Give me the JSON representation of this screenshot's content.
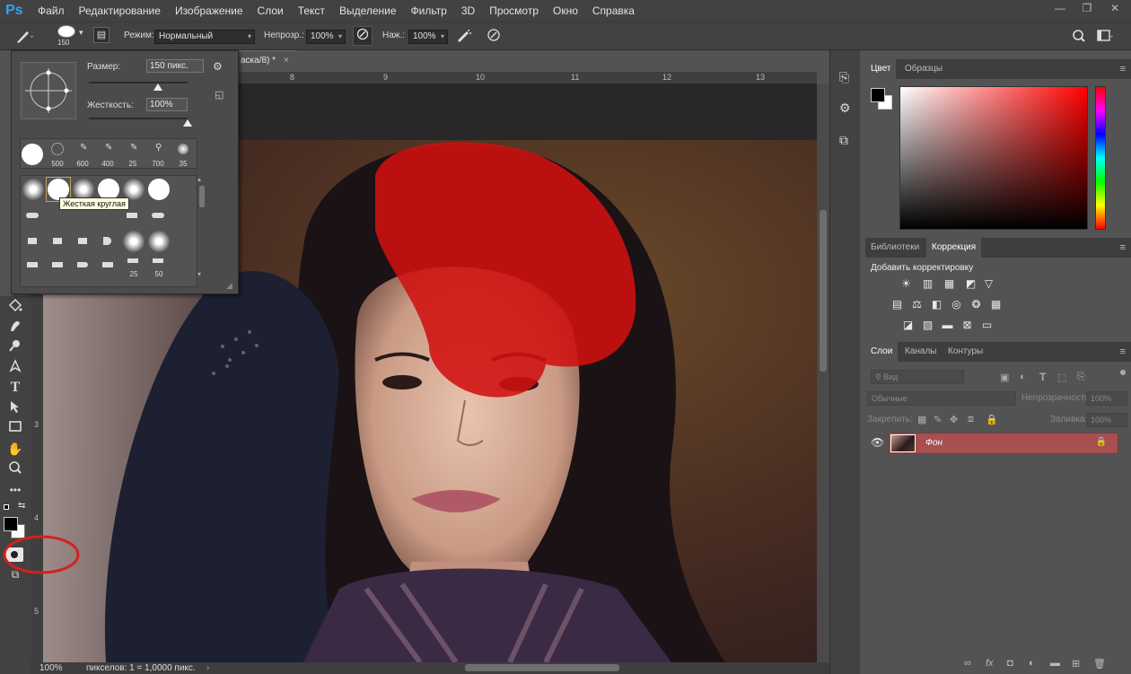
{
  "app": {
    "logo": "Ps"
  },
  "menu": [
    "Файл",
    "Редактирование",
    "Изображение",
    "Слои",
    "Текст",
    "Выделение",
    "Фильтр",
    "3D",
    "Просмотр",
    "Окно",
    "Справка"
  ],
  "window_controls": {
    "minimize": "—",
    "restore": "❐",
    "close": "✕"
  },
  "options": {
    "brush_size": "150",
    "mode_label": "Режим:",
    "mode_value": "Нормальный",
    "opacity_label": "Непрозр.:",
    "opacity_value": "100%",
    "flow_label": "Наж.:",
    "flow_value": "100%"
  },
  "document": {
    "tab_title": "аска/8) *",
    "tab_close": "×",
    "zoom": "100%",
    "status": "пикселов: 1 = 1,0000 пикс."
  },
  "ruler": {
    "top": [
      "8",
      "9",
      "10",
      "11",
      "12",
      "13"
    ],
    "left": [
      "3",
      "4",
      "5"
    ]
  },
  "brush_panel": {
    "size_label": "Размер:",
    "size_value": "150 пикс.",
    "hardness_label": "Жесткость:",
    "hardness_value": "100%",
    "size_level": 0.7,
    "hardness_level": 1.0,
    "presets": [
      "",
      "500",
      "600",
      "400",
      "25",
      "700",
      "35"
    ],
    "grid_numbers": [
      "25",
      "50"
    ],
    "tooltip": "Жесткая круглая"
  },
  "color_panel": {
    "tabs": [
      "Цвет",
      "Образцы"
    ],
    "foreground": "#000000",
    "background": "#ffffff",
    "hue": "#ff0000"
  },
  "adjust_panel": {
    "tabs": [
      "Библиотеки",
      "Коррекция"
    ],
    "heading": "Добавить корректировку"
  },
  "layers_panel": {
    "tabs": [
      "Слои",
      "Каналы",
      "Контуры"
    ],
    "search_placeholder": "Вид",
    "blend_mode": "Обычные",
    "opacity_label": "Непрозрачность:",
    "opacity_value": "100%",
    "lock_label": "Закрепить:",
    "fill_label": "Заливка:",
    "fill_value": "100%",
    "layer_name": "Фон",
    "footer_icons": [
      "link-icon",
      "fx-icon",
      "mask-icon",
      "adjustment-icon",
      "folder-icon",
      "new-layer-icon",
      "trash-icon"
    ]
  },
  "colors": {
    "accent": "#2fa3f7",
    "mask_red": "#d01010",
    "layer_selected": "#a84f4f",
    "annotation": "#d42020"
  }
}
